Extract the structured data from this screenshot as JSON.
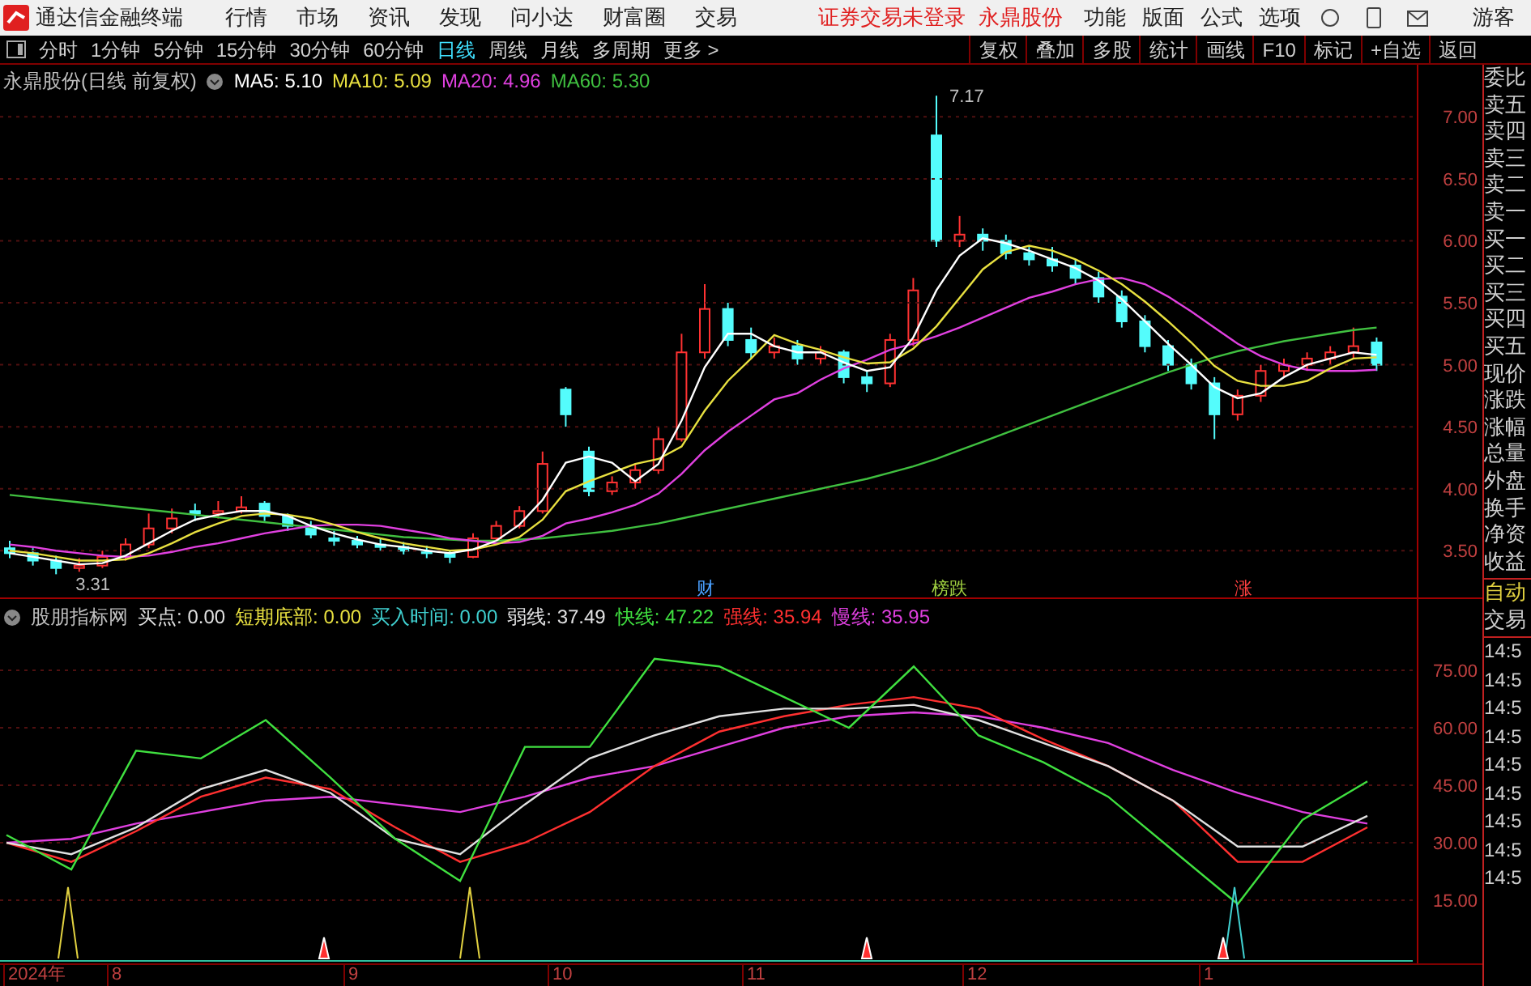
{
  "title_bar": {
    "app_name": "通达信金融终端",
    "menus": [
      "行情",
      "市场",
      "资讯",
      "发现",
      "问小达",
      "财富圈",
      "交易"
    ],
    "status": [
      "证券交易未登录",
      "永鼎股份"
    ],
    "right_menus": [
      "功能",
      "版面",
      "公式",
      "选项"
    ],
    "user": "游客"
  },
  "toolbar": {
    "periods": [
      {
        "label": "分时",
        "selected": false
      },
      {
        "label": "1分钟",
        "selected": false
      },
      {
        "label": "5分钟",
        "selected": false
      },
      {
        "label": "15分钟",
        "selected": false
      },
      {
        "label": "30分钟",
        "selected": false
      },
      {
        "label": "60分钟",
        "selected": false
      },
      {
        "label": "日线",
        "selected": true
      },
      {
        "label": "周线",
        "selected": false
      },
      {
        "label": "月线",
        "selected": false
      },
      {
        "label": "多周期",
        "selected": false
      }
    ],
    "more": "更多 >",
    "tools": [
      "复权",
      "叠加",
      "多股",
      "统计",
      "画线",
      "F10",
      "标记",
      "+自选",
      "返回"
    ]
  },
  "main_chart": {
    "title": "永鼎股份(日线 前复权)",
    "legend": [
      {
        "label": "MA5:",
        "value": "5.10",
        "color": "#ffffff"
      },
      {
        "label": "MA10:",
        "value": "5.09",
        "color": "#e8e040"
      },
      {
        "label": "MA20:",
        "value": "4.96",
        "color": "#e040e0"
      },
      {
        "label": "MA60:",
        "value": "5.30",
        "color": "#40c040"
      }
    ],
    "chart_data": {
      "type": "candlestick",
      "ohlc": [
        [
          3.52,
          3.58,
          3.44,
          3.48
        ],
        [
          3.48,
          3.52,
          3.38,
          3.42
        ],
        [
          3.42,
          3.46,
          3.31,
          3.36
        ],
        [
          3.36,
          3.44,
          3.33,
          3.38
        ],
        [
          3.38,
          3.5,
          3.36,
          3.45
        ],
        [
          3.45,
          3.6,
          3.42,
          3.55
        ],
        [
          3.55,
          3.8,
          3.52,
          3.68
        ],
        [
          3.68,
          3.84,
          3.64,
          3.76
        ],
        [
          3.82,
          3.88,
          3.74,
          3.8
        ],
        [
          3.8,
          3.9,
          3.76,
          3.82
        ],
        [
          3.82,
          3.94,
          3.8,
          3.85
        ],
        [
          3.88,
          3.9,
          3.74,
          3.78
        ],
        [
          3.78,
          3.8,
          3.66,
          3.7
        ],
        [
          3.7,
          3.74,
          3.6,
          3.63
        ],
        [
          3.6,
          3.66,
          3.54,
          3.58
        ],
        [
          3.58,
          3.62,
          3.52,
          3.55
        ],
        [
          3.55,
          3.6,
          3.5,
          3.53
        ],
        [
          3.53,
          3.57,
          3.47,
          3.5
        ],
        [
          3.5,
          3.54,
          3.44,
          3.48
        ],
        [
          3.48,
          3.5,
          3.4,
          3.45
        ],
        [
          3.45,
          3.64,
          3.44,
          3.6
        ],
        [
          3.6,
          3.74,
          3.58,
          3.7
        ],
        [
          3.7,
          3.86,
          3.68,
          3.82
        ],
        [
          3.82,
          4.3,
          3.8,
          4.2
        ],
        [
          4.8,
          4.82,
          4.5,
          4.6
        ],
        [
          4.3,
          4.34,
          3.94,
          3.98
        ],
        [
          3.98,
          4.1,
          3.95,
          4.05
        ],
        [
          4.05,
          4.2,
          4.0,
          4.15
        ],
        [
          4.15,
          4.5,
          4.12,
          4.4
        ],
        [
          4.4,
          5.25,
          4.38,
          5.1
        ],
        [
          5.1,
          5.65,
          5.05,
          5.45
        ],
        [
          5.45,
          5.5,
          5.15,
          5.2
        ],
        [
          5.2,
          5.3,
          5.05,
          5.1
        ],
        [
          5.1,
          5.22,
          5.05,
          5.15
        ],
        [
          5.15,
          5.2,
          5.0,
          5.05
        ],
        [
          5.05,
          5.15,
          5.0,
          5.1
        ],
        [
          5.1,
          5.12,
          4.85,
          4.9
        ],
        [
          4.9,
          4.95,
          4.78,
          4.85
        ],
        [
          4.85,
          5.25,
          4.82,
          5.2
        ],
        [
          5.2,
          5.7,
          5.15,
          5.6
        ],
        [
          6.85,
          7.17,
          5.95,
          6.0
        ],
        [
          6.0,
          6.2,
          5.95,
          6.05
        ],
        [
          6.05,
          6.1,
          5.92,
          6.0
        ],
        [
          6.0,
          6.05,
          5.85,
          5.9
        ],
        [
          5.9,
          5.95,
          5.8,
          5.85
        ],
        [
          5.85,
          5.95,
          5.75,
          5.8
        ],
        [
          5.8,
          5.85,
          5.65,
          5.7
        ],
        [
          5.7,
          5.75,
          5.5,
          5.55
        ],
        [
          5.55,
          5.6,
          5.3,
          5.35
        ],
        [
          5.35,
          5.4,
          5.1,
          5.15
        ],
        [
          5.15,
          5.2,
          4.95,
          5.0
        ],
        [
          5.0,
          5.05,
          4.8,
          4.85
        ],
        [
          4.85,
          4.9,
          4.4,
          4.6
        ],
        [
          4.6,
          4.8,
          4.55,
          4.75
        ],
        [
          4.75,
          5.0,
          4.7,
          4.95
        ],
        [
          4.95,
          5.05,
          4.9,
          5.0
        ],
        [
          5.0,
          5.1,
          4.95,
          5.05
        ],
        [
          5.05,
          5.15,
          5.0,
          5.1
        ],
        [
          5.1,
          5.3,
          5.05,
          5.15
        ],
        [
          5.18,
          5.22,
          4.95,
          5.0
        ]
      ]
    },
    "moving_averages": {
      "chart_data": {
        "type": "line",
        "grid": true,
        "ylim": [
          3.11,
          7.42
        ],
        "yticks": [
          {
            "value": 7,
            "label": "7.00"
          },
          {
            "value": 6.5,
            "label": "6.50"
          },
          {
            "value": 6,
            "label": "6.00"
          },
          {
            "value": 5.5,
            "label": "5.50"
          },
          {
            "value": 5,
            "label": "5.00"
          },
          {
            "value": 4.5,
            "label": "4.50"
          },
          {
            "value": 4,
            "label": "4.00"
          },
          {
            "value": 3.5,
            "label": "3.50"
          }
        ],
        "series": [
          {
            "color": "#40c040",
            "values": [
              3.95,
              3.93,
              3.91,
              3.89,
              3.87,
              3.85,
              3.83,
              3.81,
              3.79,
              3.77,
              3.75,
              3.73,
              3.71,
              3.69,
              3.67,
              3.65,
              3.63,
              3.61,
              3.6,
              3.59,
              3.58,
              3.58,
              3.59,
              3.6,
              3.62,
              3.64,
              3.66,
              3.69,
              3.72,
              3.76,
              3.8,
              3.84,
              3.88,
              3.92,
              3.96,
              4.0,
              4.04,
              4.08,
              4.13,
              4.18,
              4.24,
              4.31,
              4.38,
              4.45,
              4.52,
              4.59,
              4.66,
              4.73,
              4.8,
              4.87,
              4.94,
              5.0,
              5.06,
              5.11,
              5.15,
              5.19,
              5.22,
              5.25,
              5.28,
              5.3
            ]
          },
          {
            "color": "#e040e0",
            "values": [
              3.55,
              3.53,
              3.5,
              3.48,
              3.46,
              3.45,
              3.46,
              3.49,
              3.53,
              3.56,
              3.6,
              3.64,
              3.67,
              3.7,
              3.71,
              3.71,
              3.7,
              3.67,
              3.64,
              3.6,
              3.58,
              3.56,
              3.57,
              3.62,
              3.72,
              3.76,
              3.81,
              3.87,
              3.96,
              4.12,
              4.31,
              4.46,
              4.59,
              4.72,
              4.77,
              4.88,
              4.97,
              5.04,
              5.12,
              5.17,
              5.23,
              5.3,
              5.38,
              5.46,
              5.54,
              5.59,
              5.65,
              5.69,
              5.7,
              5.65,
              5.55,
              5.43,
              5.3,
              5.17,
              5.07,
              5.0,
              4.96,
              4.95,
              4.95,
              4.96
            ]
          },
          {
            "color": "#e8e040",
            "values": [
              3.5,
              3.48,
              3.45,
              3.42,
              3.42,
              3.43,
              3.48,
              3.56,
              3.65,
              3.72,
              3.78,
              3.8,
              3.79,
              3.76,
              3.71,
              3.65,
              3.6,
              3.56,
              3.53,
              3.5,
              3.51,
              3.55,
              3.61,
              3.75,
              3.98,
              4.06,
              4.13,
              4.2,
              4.24,
              4.34,
              4.63,
              4.87,
              5.05,
              5.24,
              5.17,
              5.12,
              5.06,
              5.01,
              5.02,
              5.13,
              5.31,
              5.54,
              5.77,
              5.91,
              5.96,
              5.92,
              5.85,
              5.76,
              5.65,
              5.51,
              5.35,
              5.18,
              4.99,
              4.87,
              4.83,
              4.83,
              4.87,
              4.97,
              5.05,
              5.06
            ]
          },
          {
            "color": "#ffffff",
            "values": [
              3.48,
              3.45,
              3.42,
              3.39,
              3.4,
              3.46,
              3.56,
              3.66,
              3.75,
              3.79,
              3.82,
              3.82,
              3.78,
              3.7,
              3.64,
              3.59,
              3.55,
              3.53,
              3.5,
              3.48,
              3.51,
              3.58,
              3.71,
              3.91,
              4.21,
              4.26,
              4.21,
              4.06,
              4.2,
              4.55,
              4.98,
              5.25,
              5.25,
              5.15,
              5.1,
              5.1,
              5.02,
              4.95,
              4.98,
              5.22,
              5.6,
              5.88,
              6.02,
              5.98,
              5.92,
              5.85,
              5.78,
              5.68,
              5.53,
              5.35,
              5.17,
              5.0,
              4.82,
              4.73,
              4.77,
              4.9,
              5.0,
              5.05,
              5.1,
              5.08
            ]
          }
        ]
      }
    },
    "high_label": "7.17",
    "low_label": "3.31",
    "signals": [
      {
        "text": "财",
        "color": "#4aa0ff"
      },
      {
        "text": "榜跌",
        "color": "#a0d040"
      },
      {
        "text": "涨",
        "color": "#ff4040"
      }
    ]
  },
  "indicator": {
    "title": "股朋指标网",
    "legend": [
      {
        "label": "买点:",
        "value": "0.00",
        "color": "#e0e0e0"
      },
      {
        "label": "短期底部:",
        "value": "0.00",
        "color": "#e8e040"
      },
      {
        "label": "买入时间:",
        "value": "0.00",
        "color": "#40d0d0"
      },
      {
        "label": "弱线:",
        "value": "37.49",
        "color": "#e0e0e1"
      },
      {
        "label": "快线:",
        "value": "47.22",
        "color": "#40e040"
      },
      {
        "label": "强线:",
        "value": "35.94",
        "color": "#ff3030"
      },
      {
        "label": "慢线:",
        "value": "35.95",
        "color": "#e040e0"
      }
    ],
    "chart_data": {
      "type": "line",
      "grid": true,
      "ylim": [
        -1.48,
        93.59
      ],
      "yticks": [
        {
          "value": 75,
          "label": "75.00"
        },
        {
          "value": 60,
          "label": "60.00"
        },
        {
          "value": 45,
          "label": "45.00"
        },
        {
          "value": 30,
          "label": "30.00"
        },
        {
          "value": 15,
          "label": "15.00"
        }
      ],
      "series": [
        {
          "color": "#e040e0",
          "values": [
            30,
            31,
            35,
            38,
            41,
            42,
            40,
            38,
            42,
            47,
            50,
            55,
            60,
            63,
            64,
            63,
            60,
            56,
            49,
            43,
            38,
            35
          ]
        },
        {
          "color": "#ff3030",
          "values": [
            30,
            25,
            33,
            42,
            47,
            44,
            34,
            25,
            30,
            38,
            50,
            59,
            63,
            66,
            68,
            65,
            57,
            50,
            41,
            25,
            25,
            34
          ]
        },
        {
          "color": "#e0e0e0",
          "values": [
            30,
            27,
            34,
            44,
            49,
            43,
            31,
            27,
            40,
            52,
            58,
            63,
            65,
            65,
            66,
            62,
            56,
            50,
            41,
            29,
            29,
            37
          ]
        },
        {
          "color": "#40e040",
          "values": [
            32,
            23,
            54,
            52,
            62,
            47,
            31,
            20,
            55,
            55,
            78,
            76,
            68,
            60,
            76,
            58,
            51,
            42,
            28,
            14,
            36,
            46
          ]
        }
      ]
    }
  },
  "x_axis": [
    "2024年",
    "8",
    "9",
    "10",
    "11",
    "12",
    "1"
  ],
  "side_panel": {
    "quote_labels": [
      "委比",
      "卖五",
      "卖四",
      "卖三",
      "卖二",
      "卖一",
      "买一",
      "买二",
      "买三",
      "买四",
      "买五",
      "现价",
      "涨跌",
      "涨幅",
      "总量",
      "外盘",
      "换手",
      "净资",
      "收益"
    ],
    "trade_labels": [
      "自动",
      "交易"
    ],
    "times": [
      "14:5",
      "14:5",
      "14:5",
      "14:5",
      "14:5",
      "14:5",
      "14:5",
      "14:5",
      "14:5"
    ]
  }
}
